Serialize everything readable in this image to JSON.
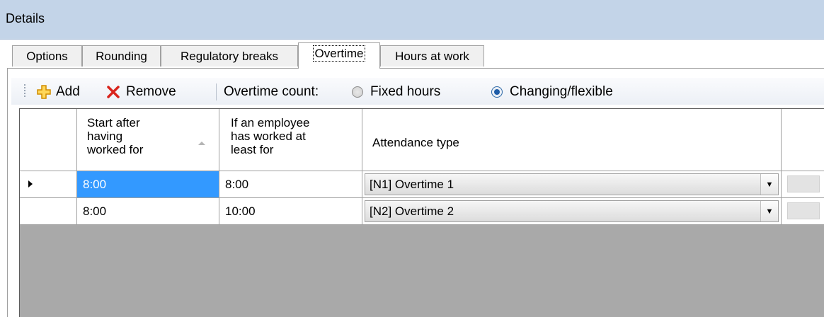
{
  "header": {
    "title": "Details"
  },
  "tabs": [
    {
      "label": "Options"
    },
    {
      "label": "Rounding"
    },
    {
      "label": "Regulatory breaks"
    },
    {
      "label": "Overtime"
    },
    {
      "label": "Hours at work"
    }
  ],
  "toolbar": {
    "add_label": "Add",
    "remove_label": "Remove",
    "overtime_count_label": "Overtime count:",
    "option_fixed": "Fixed hours",
    "option_flexible": "Changing/flexible",
    "selected_option": "Changing/flexible",
    "add_icon_color": "#f2a900",
    "remove_icon_color": "#d9241c"
  },
  "grid": {
    "columns": {
      "start_after": {
        "line1": "Start after",
        "line2": "having",
        "line3": "worked for"
      },
      "if_worked": {
        "line1": "If an employee",
        "line2": "has worked at",
        "line3": "least for"
      },
      "attendance": "Attendance type"
    },
    "rows": [
      {
        "start_after": "8:00",
        "if_worked": "8:00",
        "attendance": "[N1]  Overtime 1"
      },
      {
        "start_after": "8:00",
        "if_worked": "10:00",
        "attendance": "[N2]  Overtime 2"
      }
    ]
  }
}
